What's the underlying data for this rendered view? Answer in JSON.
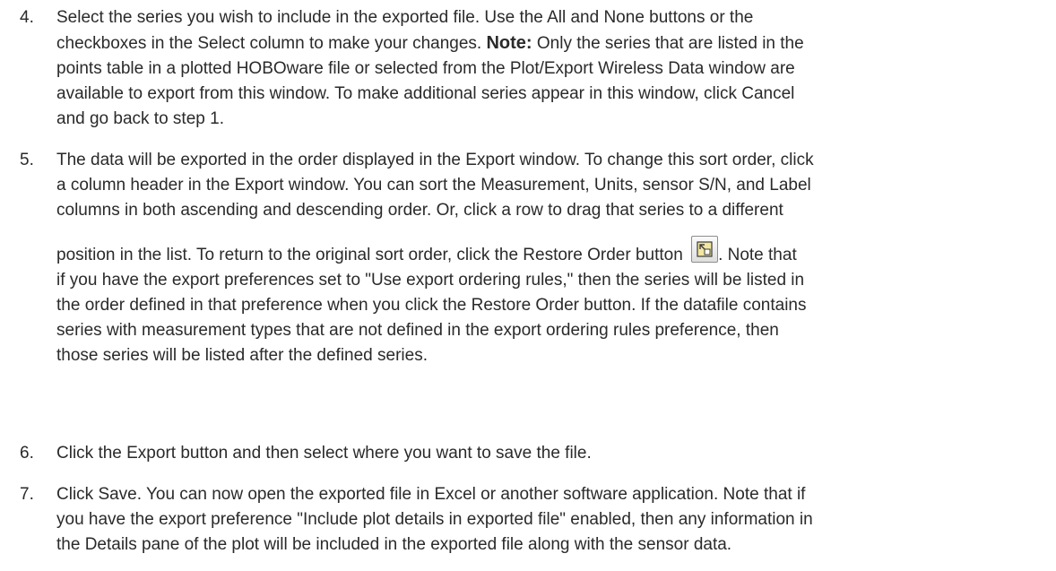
{
  "steps": [
    {
      "number": "4.",
      "lines": [
        "Select the series you wish to include in the exported file. Use the All and None buttons or the",
        "checkboxes in the Select column to make your changes. ",
        "points table in a plotted HOBOware file or selected from the Plot/Export Wireless Data window are",
        "available to export from this window. To make additional series appear in this window, click Cancel",
        "and go back to step 1."
      ],
      "note_label": "Note:",
      "note_tail": " Only the series that are listed in the"
    },
    {
      "number": "5.",
      "lines": [
        "The data will be exported in the order displayed in the Export window. To change this sort order, click",
        "a column header in the Export window. You can sort the Measurement, Units, sensor S/N, and Label",
        "columns in both ascending and descending order. Or, click a row to drag that series to a different",
        "position in the list. To return to the original sort order, click the Restore Order button ",
        ". Note that",
        "if you have the export preferences set to \"Use export ordering rules,\" then the series will be listed in",
        "the order defined in that preference when you click the Restore Order button. If the datafile contains",
        "series with measurement types that are not defined in the export ordering rules preference, then",
        "those series will be listed after the defined series."
      ],
      "restore_button_icon": "restore-order-icon"
    },
    {
      "number": "6.",
      "lines": [
        "Click the Export button and then select where you want to save the file."
      ]
    },
    {
      "number": "7.",
      "lines": [
        "Click Save. You can now open the exported file in Excel or another software application. Note that if",
        "you have the export preference \"Include plot details in exported file\" enabled, then any information in",
        "the Details pane of the plot will be included in the exported file along with the sensor data."
      ]
    }
  ],
  "colors": {
    "text": "#2a2a2a",
    "icon_fill": "#f2e6a0",
    "icon_stroke": "#3a3a3a"
  }
}
